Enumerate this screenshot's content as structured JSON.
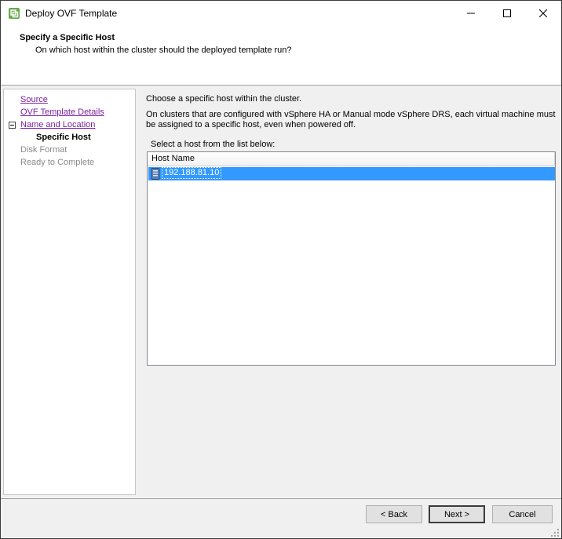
{
  "window": {
    "title": "Deploy OVF Template",
    "icon": "vsphere-app-icon",
    "controls": {
      "minimize": "minimize-icon",
      "maximize": "maximize-icon",
      "close": "close-icon"
    }
  },
  "header": {
    "title": "Specify a Specific Host",
    "subtitle": "On which host within the cluster should the deployed template run?"
  },
  "nav": {
    "items": [
      {
        "label": "Source",
        "state": "link"
      },
      {
        "label": "OVF Template Details",
        "state": "link"
      },
      {
        "label": "Name and Location",
        "state": "link"
      },
      {
        "label": "Specific Host",
        "state": "current"
      },
      {
        "label": "Disk Format",
        "state": "disabled"
      },
      {
        "label": "Ready to Complete",
        "state": "disabled"
      }
    ]
  },
  "content": {
    "intro": "Choose a specific host within the cluster.",
    "description_line1": "On clusters that are configured with vSphere HA or Manual mode vSphere DRS, each virtual machine must",
    "description_line2": "be assigned to a specific host, even when powered off.",
    "list_label": "Select a host from the list below:",
    "column_header": "Host Name",
    "hosts": [
      {
        "name": "192.188.81.10",
        "selected": true,
        "icon": "host-server-icon"
      }
    ]
  },
  "footer": {
    "back_label": "< Back",
    "next_label": "Next >",
    "cancel_label": "Cancel"
  },
  "colors": {
    "link": "#7a1fa2",
    "selection": "#3399ff",
    "disabled_text": "#8a8a8a",
    "panel_bg": "#f0f0f0"
  }
}
